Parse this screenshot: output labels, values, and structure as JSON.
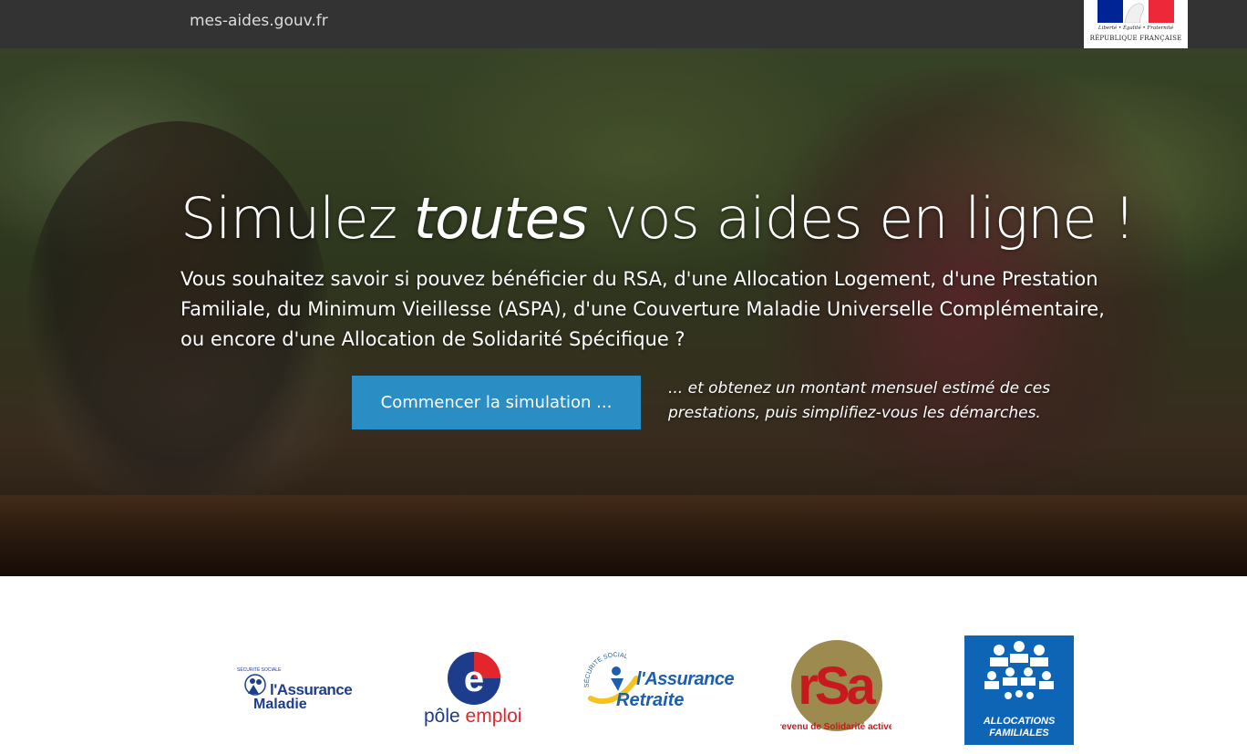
{
  "header": {
    "site_name": "mes-aides.gouv.fr",
    "gov_logo": {
      "motto": "Liberté • Égalité • Fraternité",
      "name": "RÉPUBLIQUE FRANÇAISE",
      "colors": {
        "blue": "#002395",
        "white": "#ffffff",
        "red": "#ed2939"
      }
    }
  },
  "hero": {
    "headline_before": "Simulez ",
    "headline_em": "toutes",
    "headline_after": " vos aides en ligne !",
    "intro": "Vous souhaitez savoir si pouvez bénéficier du RSA, d'une Allocation Logement, d'une Prestation Familiale, du Minimum Vieillesse (ASPA), d'une Couverture Maladie Universelle Complémentaire, ou encore d'une Allocation de Solidarité Spécifique ?",
    "cta_label": "Commencer la simulation ...",
    "cta_note": "... et obtenez un montant mensuel estimé de ces prestations, puis simplifiez-vous les démarches."
  },
  "partners": [
    {
      "id": "assurance-maladie",
      "line1": "l'Assurance",
      "line2": "Maladie",
      "small": "SÉCURITÉ SOCIALE",
      "color": "#1d3e8a"
    },
    {
      "id": "pole-emploi",
      "word1": "pôle",
      "word2": "emploi",
      "glyph": "e",
      "blue": "#1e3c8c",
      "red": "#e3262b"
    },
    {
      "id": "assurance-retraite",
      "line1": "l'Assurance",
      "line2": "Retraite",
      "small": "SÉCURITÉ SOCIALE",
      "blue": "#1d5fae",
      "yellow": "#f6c21c"
    },
    {
      "id": "rsa",
      "logo_text": "rSa",
      "caption": "revenu de Solidarité active",
      "red": "#c8191e",
      "bg": "#9c8a4e"
    },
    {
      "id": "caf",
      "line1": "ALLOCATIONS",
      "line2": "FAMILIALES",
      "bg": "#0f65b5"
    }
  ]
}
